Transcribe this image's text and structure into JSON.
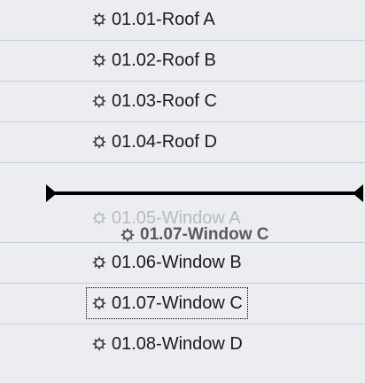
{
  "list": {
    "items": [
      {
        "label": "01.01-Roof A",
        "icon": "gear-icon"
      },
      {
        "label": "01.02-Roof B",
        "icon": "gear-icon"
      },
      {
        "label": "01.03-Roof C",
        "icon": "gear-icon"
      },
      {
        "label": "01.04-Roof D",
        "icon": "gear-icon"
      },
      {
        "label": "01.05-Window A",
        "icon": "gear-icon"
      },
      {
        "label": "01.06-Window B",
        "icon": "gear-icon"
      },
      {
        "label": "01.07-Window C",
        "icon": "gear-icon"
      },
      {
        "label": "01.08-Window D",
        "icon": "gear-icon"
      }
    ],
    "focused_item": "01.07-Window C"
  },
  "drag": {
    "ghost_label": "01.07-Window C",
    "insertion_after": "01.04-Roof D"
  },
  "colors": {
    "background": "#ebedf1",
    "row_separator": "#c8ccd4",
    "text": "#1b1b1b",
    "drop_indicator": "#000000"
  }
}
